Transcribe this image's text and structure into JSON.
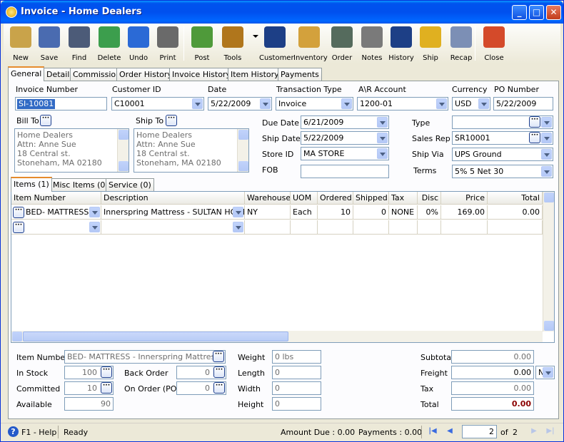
{
  "window": {
    "title": "Invoice - Home Dealers"
  },
  "toolbar": [
    {
      "label": "New",
      "icon": "new-icon",
      "color": "#c9a34a"
    },
    {
      "label": "Save",
      "icon": "save-icon",
      "color": "#4a6bb0"
    },
    {
      "label": "Find",
      "icon": "find-icon",
      "color": "#4c5b78"
    },
    {
      "label": "Delete",
      "icon": "delete-icon",
      "color": "#3c9e4d"
    },
    {
      "label": "Undo",
      "icon": "undo-icon",
      "color": "#2b6ad6"
    },
    {
      "label": "Print",
      "icon": "print-icon",
      "color": "#6a6a6a"
    },
    {
      "label": "Post",
      "icon": "post-icon",
      "color": "#4f9a3a"
    },
    {
      "label": "Tools",
      "icon": "tools-icon",
      "color": "#b0761c"
    },
    {
      "label": "Customer",
      "icon": "customer-icon",
      "color": "#1d3f86"
    },
    {
      "label": "Inventory",
      "icon": "inventory-icon",
      "color": "#d3a13c"
    },
    {
      "label": "Order",
      "icon": "order-icon",
      "color": "#556b5d"
    },
    {
      "label": "Notes",
      "icon": "notes-icon",
      "color": "#7a7a7a"
    },
    {
      "label": "History",
      "icon": "history-icon",
      "color": "#1d3f86"
    },
    {
      "label": "Ship",
      "icon": "ship-icon",
      "color": "#e0b020"
    },
    {
      "label": "Recap",
      "icon": "recap-icon",
      "color": "#7c8fb5"
    },
    {
      "label": "Close",
      "icon": "close-doc-icon",
      "color": "#d44a2a"
    }
  ],
  "tabs": [
    "General",
    "Detail",
    "Commission",
    "Order History",
    "Invoice History",
    "Item History",
    "Payments"
  ],
  "header": {
    "invoice_number_label": "Invoice Number",
    "invoice_number": "SI-10081",
    "customer_id_label": "Customer ID",
    "customer_id": "C10001",
    "date_label": "Date",
    "date": "5/22/2009",
    "transaction_type_label": "Transaction Type",
    "transaction_type": "Invoice",
    "ar_account_label": "A\\R Account",
    "ar_account": "1200-01",
    "currency_label": "Currency",
    "currency": "USD",
    "po_number_label": "PO Number",
    "po_number": "5/22/2009"
  },
  "bill_to": {
    "label": "Bill To",
    "lines": [
      "Home Dealers",
      "Attn: Anne Sue",
      "18 Central st.",
      "Stoneham, MA 02180"
    ]
  },
  "ship_to": {
    "label": "Ship To",
    "lines": [
      "Home Dealers",
      "Attn: Anne Sue",
      "18 Central st.",
      "Stoneham, MA 02180"
    ]
  },
  "dates": {
    "due_date_label": "Due Date",
    "due_date": "6/21/2009",
    "ship_date_label": "Ship Date",
    "ship_date": "5/22/2009",
    "store_id_label": "Store ID",
    "store_id": "MA STORE",
    "fob_label": "FOB",
    "fob": ""
  },
  "right": {
    "type_label": "Type",
    "type": "",
    "sales_rep_label": "Sales Rep",
    "sales_rep": "SR10001",
    "ship_via_label": "Ship Via",
    "ship_via": "UPS Ground",
    "terms_label": "Terms",
    "terms": "5% 5 Net 30"
  },
  "subtabs": [
    "Items (1)",
    "Misc Items (0)",
    "Service (0)"
  ],
  "grid": {
    "columns": [
      "Item Number",
      "Description",
      "Warehouse",
      "UOM",
      "Ordered",
      "Shipped",
      "Tax",
      "Disc",
      "Price",
      "Total"
    ],
    "rows": [
      [
        "BED- MATTRESS",
        "Innerspring Mattress - SULTAN HOGBO",
        "NY",
        "Each",
        "10",
        "0",
        "NONE",
        "0%",
        "169.00",
        "0.00"
      ],
      [
        "",
        "",
        "",
        "",
        "",
        "",
        "",
        "",
        "",
        ""
      ]
    ]
  },
  "footer": {
    "item_number_label": "Item Number",
    "item_number": "BED- MATTRESS - Innerspring Mattress - S",
    "in_stock_label": "In Stock",
    "in_stock": "100",
    "committed_label": "Committed",
    "committed": "10",
    "available_label": "Available",
    "available": "90",
    "back_order_label": "Back Order",
    "back_order": "0",
    "on_order_label": "On Order (PO)",
    "on_order": "0",
    "weight_label": "Weight",
    "weight": "0 lbs",
    "length_label": "Length",
    "length": "0",
    "width_label": "Width",
    "width": "0",
    "height_label": "Height",
    "height": "0",
    "subtotal_label": "Subtotal",
    "subtotal": "0.00",
    "freight_label": "Freight",
    "freight": "0.00",
    "freight_code": "N",
    "tax_label": "Tax",
    "tax": "0.00",
    "total_label": "Total",
    "total": "0.00"
  },
  "status": {
    "help": "F1 - Help",
    "state": "Ready",
    "amount_due": "Amount Due : 0.00",
    "payments": "Payments : 0.00",
    "page": "2",
    "of": "of",
    "pages": "2"
  }
}
